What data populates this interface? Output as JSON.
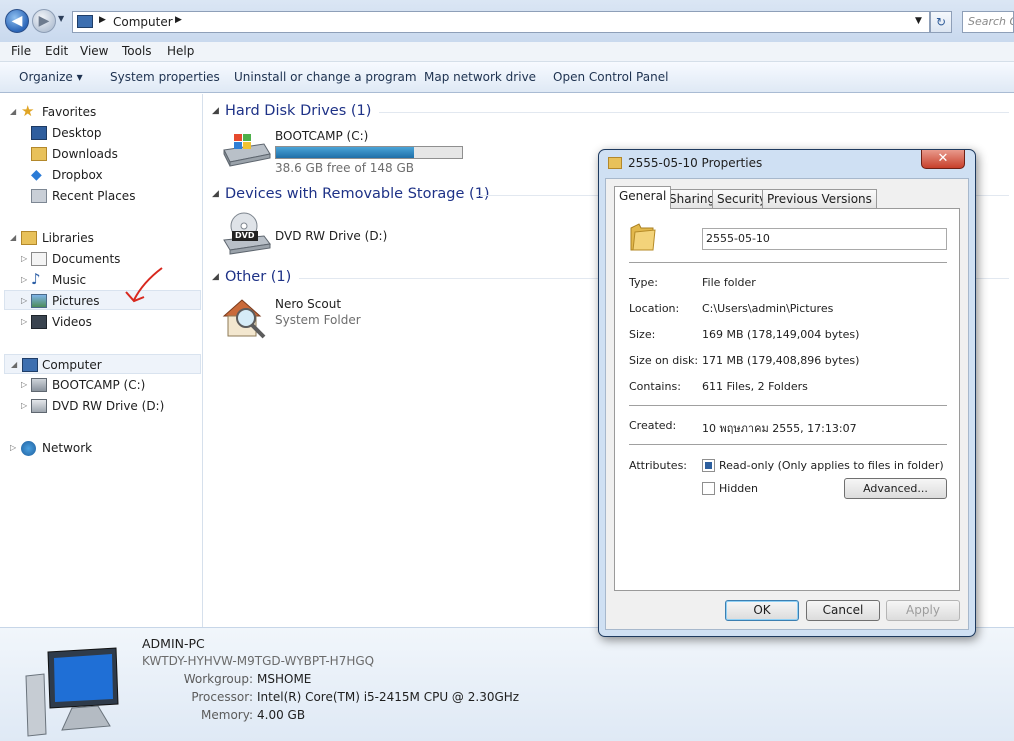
{
  "address": {
    "back_label": "◀",
    "fwd_label": "▶",
    "path": "Computer",
    "search_placeholder": "Search Computer",
    "refresh_label": "↻"
  },
  "menu": [
    "File",
    "Edit",
    "View",
    "Tools",
    "Help"
  ],
  "commands": {
    "organize": "Organize ▾",
    "system_properties": "System properties",
    "uninstall": "Uninstall or change a program",
    "map_drive": "Map network drive",
    "control_panel": "Open Control Panel"
  },
  "nav": {
    "favorites": "Favorites",
    "desktop": "Desktop",
    "downloads": "Downloads",
    "dropbox": "Dropbox",
    "recent": "Recent Places",
    "libraries": "Libraries",
    "documents": "Documents",
    "music": "Music",
    "pictures": "Pictures",
    "videos": "Videos",
    "computer": "Computer",
    "bootcamp": "BOOTCAMP (C:)",
    "dvd": "DVD RW Drive (D:)",
    "network": "Network"
  },
  "content": {
    "hdd_group": "Hard Disk Drives (1)",
    "hdd_name": "BOOTCAMP (C:)",
    "hdd_free": "38.6 GB free of 148 GB",
    "hdd_used_fraction": 0.74,
    "removable_group": "Devices with Removable Storage (1)",
    "dvd_name": "DVD RW Drive (D:)",
    "dvd_badge": "DVD",
    "other_group": "Other (1)",
    "nero_name": "Nero Scout",
    "nero_type": "System Folder"
  },
  "details": {
    "pc_name": "ADMIN-PC",
    "product_key": "KWTDY-HYHVW-M9TGD-WYBPT-H7HGQ",
    "workgroup_label": "Workgroup:",
    "workgroup": "MSHOME",
    "processor_label": "Processor:",
    "processor": "Intel(R) Core(TM) i5-2415M CPU @ 2.30GHz",
    "memory_label": "Memory:",
    "memory": "4.00 GB"
  },
  "dialog": {
    "title": "2555-05-10 Properties",
    "close_label": "✕",
    "tabs": [
      "General",
      "Sharing",
      "Security",
      "Previous Versions"
    ],
    "name_value": "2555-05-10",
    "rows": {
      "type_k": "Type:",
      "type_v": "File folder",
      "location_k": "Location:",
      "location_v": "C:\\Users\\admin\\Pictures",
      "size_k": "Size:",
      "size_v": "169 MB (178,149,004 bytes)",
      "disk_k": "Size on disk:",
      "disk_v": "171 MB (179,408,896 bytes)",
      "contains_k": "Contains:",
      "contains_v": "611 Files, 2 Folders",
      "created_k": "Created:",
      "created_v": "10 พฤษภาคม 2555, 17:13:07",
      "attrs_k": "Attributes:",
      "readonly": "Read-only (Only applies to files in folder)",
      "hidden": "Hidden",
      "advanced": "Advanced..."
    },
    "buttons": {
      "ok": "OK",
      "cancel": "Cancel",
      "apply": "Apply"
    }
  }
}
